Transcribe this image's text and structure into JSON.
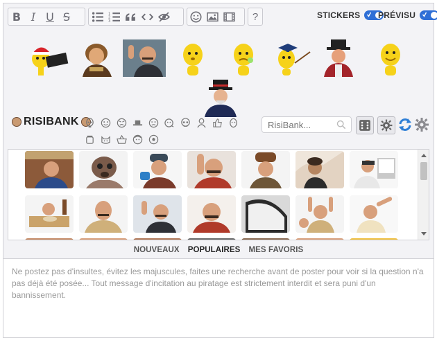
{
  "toolbar": {
    "groups": [
      [
        "bold-icon",
        "italic-icon",
        "underline-icon",
        "strike-icon"
      ],
      [
        "bullet-list-icon",
        "numbered-list-icon",
        "quote-icon",
        "code-icon",
        "spoiler-icon"
      ],
      [
        "emoji-icon",
        "image-icon",
        "video-icon"
      ],
      [
        "help-icon"
      ]
    ],
    "bold": "B",
    "italic": "I",
    "underline": "U",
    "strike": "S",
    "help": "?",
    "stickers_label": "STICKERS",
    "preview_label": "PRÉVISU",
    "accent": "#2f6fd6"
  },
  "risibank": {
    "logo_text": "RISIBANK",
    "search_placeholder": "RisiBank..."
  },
  "tabs": {
    "new": "NOUVEAUX",
    "popular": "POPULAIRES",
    "favorites": "MES FAVORIS",
    "active": "popular"
  },
  "message": {
    "placeholder": "Ne postez pas d'insultes, évitez les majuscules, faites une recherche avant de poster pour voir si la question n'a pas déjà été posée... Tout message d'incitation au piratage est strictement interdit et sera puni d'un bannissement."
  }
}
